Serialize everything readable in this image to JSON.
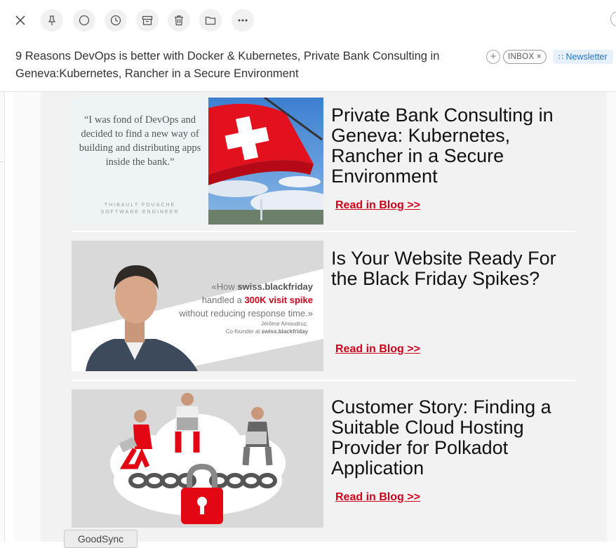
{
  "toolbar": {
    "close_icon": "close-icon",
    "buttons": [
      "pin-icon",
      "circle-icon",
      "clock-icon",
      "archive-icon",
      "trash-icon",
      "folder-icon",
      "more-icon"
    ]
  },
  "email": {
    "subject": "9 Reasons DevOps is better with Docker & Kubernetes, Private Bank Consulting in Geneva:Kubernetes, Rancher in a Secure Environment",
    "tags": {
      "add": "+",
      "inbox": "INBOX ×",
      "newsletter": "Newsletter"
    }
  },
  "cards": [
    {
      "title": "Private Bank Consulting in Geneva: Kubernetes, Rancher in a Secure Environment",
      "link": "Read in Blog >> ",
      "quote": "“I was fond of DevOps and decided to find a new way of building and distributing apps inside the bank.”",
      "quote_name": "THIBAULT FOUACHE",
      "quote_role": "SOFTWARE ENGINEER"
    },
    {
      "title": "Is Your Website Ready For the Black Friday Spikes?",
      "link": "Read in Blog >>",
      "quote_pre": "«How ",
      "quote_brand": "swiss.blackfriday",
      "quote_mid": "handled a ",
      "quote_red": "300K visit spike",
      "quote_post": "without reducing response time.»",
      "quote_name": "Jérôme Amoudruz,",
      "quote_role_pre": "Co-founder at ",
      "quote_role_brand": "swiss.blackfriday"
    },
    {
      "title": "Customer Story: Finding a Suitable Cloud Hosting Provider for Polkadot Application",
      "link": "Read in Blog >>"
    }
  ],
  "goodsync_label": "GoodSync",
  "colors": {
    "link_red": "#d0021b",
    "newsletter_blue": "#2673c9",
    "body_bg": "#f3f2f2"
  }
}
